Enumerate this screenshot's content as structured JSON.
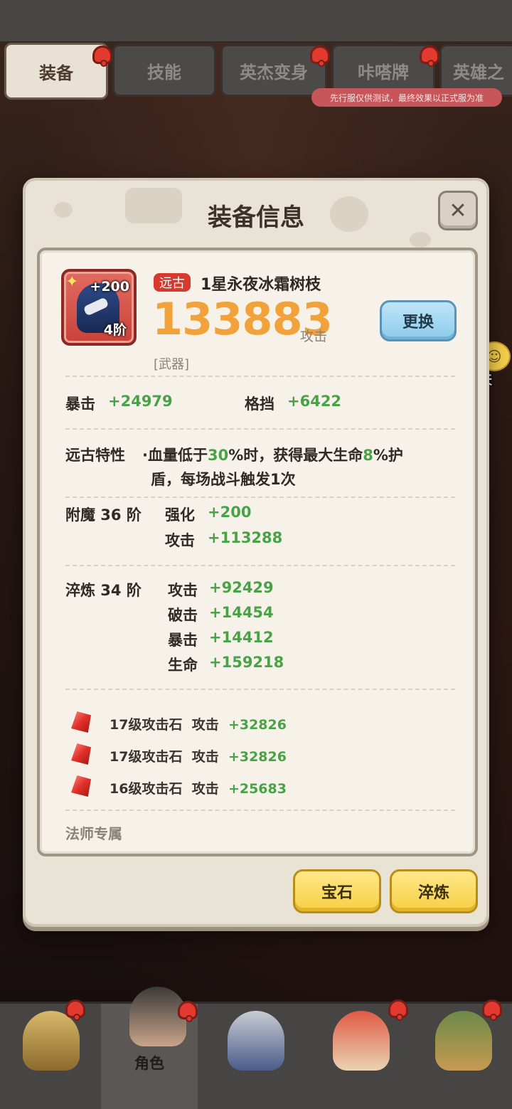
{
  "tabs": [
    {
      "label": "装备",
      "active": true
    },
    {
      "label": "技能",
      "active": false
    },
    {
      "label": "英杰变身",
      "active": false
    },
    {
      "label": "咔嗒牌",
      "active": false
    },
    {
      "label": "英雄之",
      "active": false
    }
  ],
  "test_notice": "先行服仅供测试，最终效果以正式服为准",
  "chat": {
    "label": "聊天",
    "icon": "chat-bubble-icon"
  },
  "modal": {
    "title": "装备信息",
    "close_icon": "close-icon",
    "item": {
      "rarity": "远古",
      "name": "1星永夜冰霜树枝",
      "power": "133883",
      "power_unit": "攻击",
      "type": "[武器]",
      "enhance_badge": "+200",
      "tier_badge": "4阶",
      "swap_label": "更换"
    },
    "base_stats": [
      {
        "label": "暴击",
        "value": "+24979"
      },
      {
        "label": "格挡",
        "value": "+6422"
      }
    ],
    "ancient_trait": {
      "label": "远古特性",
      "line1_a": "·血量低于",
      "line1_b": "30",
      "line1_c": "%时，获得最大生命",
      "line1_d": "8",
      "line1_e": "%护",
      "line2": "盾，每场战斗触发1次"
    },
    "enchant": {
      "label": "附魔 36 阶",
      "stats": [
        {
          "label": "强化",
          "value": "+200"
        },
        {
          "label": "攻击",
          "value": "+113288"
        }
      ]
    },
    "refine": {
      "label": "淬炼 34 阶",
      "stats": [
        {
          "label": "攻击",
          "value": "+92429"
        },
        {
          "label": "破击",
          "value": "+14454"
        },
        {
          "label": "暴击",
          "value": "+14412"
        },
        {
          "label": "生命",
          "value": "+159218"
        }
      ]
    },
    "gems": [
      {
        "name": "17级攻击石",
        "stat": "攻击",
        "value": "+32826"
      },
      {
        "name": "17级攻击石",
        "stat": "攻击",
        "value": "+32826"
      },
      {
        "name": "16级攻击石",
        "stat": "攻击",
        "value": "+25683"
      }
    ],
    "class_restriction": "法师专属",
    "gem_button": "宝石",
    "refine_button": "淬炼"
  },
  "bottom_nav": [
    {
      "label": "",
      "icon": "hero-1-icon"
    },
    {
      "label": "角色",
      "icon": "hero-2-icon",
      "active": true
    },
    {
      "label": "",
      "icon": "equipment-icon"
    },
    {
      "label": "",
      "icon": "pet-icon"
    },
    {
      "label": "",
      "icon": "hero-5-icon"
    }
  ],
  "colors": {
    "accent_power": "#f1a23b",
    "stat_green": "#4aa246",
    "rarity_red": "#d6392e",
    "notification_red": "#e23a2e"
  }
}
